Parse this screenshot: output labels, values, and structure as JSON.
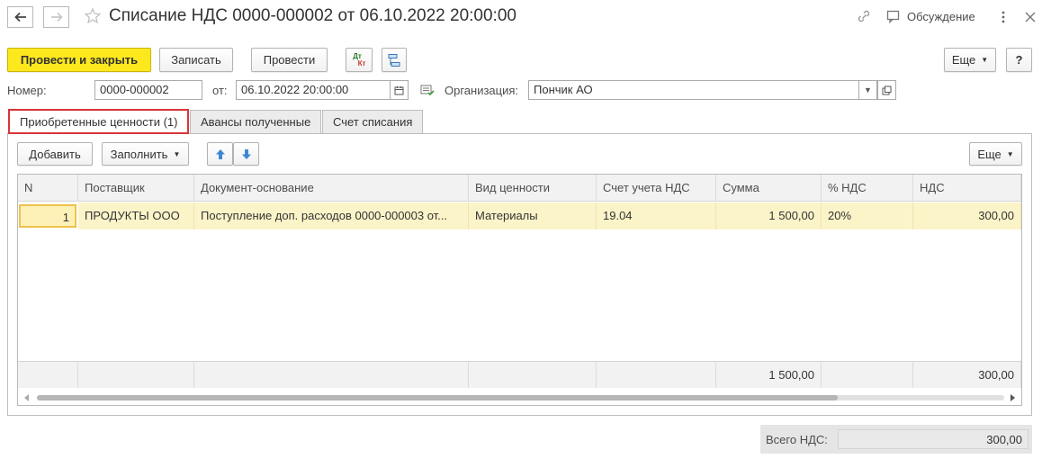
{
  "window": {
    "title": "Списание НДС 0000-000002 от 06.10.2022 20:00:00",
    "discussion_label": "Обсуждение"
  },
  "toolbar": {
    "post_and_close": "Провести и закрыть",
    "save": "Записать",
    "post": "Провести",
    "dt_label": "Дт",
    "kt_label": "Кт",
    "more": "Еще",
    "help": "?"
  },
  "form": {
    "number_label": "Номер:",
    "number_value": "0000-000002",
    "date_label": "от:",
    "date_value": "06.10.2022 20:00:00",
    "org_label": "Организация:",
    "org_value": "Пончик АО"
  },
  "tabs": [
    {
      "label": "Приобретенные ценности (1)",
      "active": true
    },
    {
      "label": "Авансы полученные",
      "active": false
    },
    {
      "label": "Счет списания",
      "active": false
    }
  ],
  "table_toolbar": {
    "add": "Добавить",
    "fill": "Заполнить",
    "more": "Еще"
  },
  "table": {
    "columns": [
      "N",
      "Поставщик",
      "Документ-основание",
      "Вид ценности",
      "Счет учета НДС",
      "Сумма",
      "% НДС",
      "НДС"
    ],
    "rows": [
      [
        "1",
        "ПРОДУКТЫ ООО",
        "Поступление доп. расходов 0000-000003 от...",
        "Материалы",
        "19.04",
        "1 500,00",
        "20%",
        "300,00"
      ]
    ],
    "footer": {
      "sum": "1 500,00",
      "vat": "300,00"
    }
  },
  "totals": {
    "vat_label": "Всего НДС:",
    "vat_value": "300,00"
  },
  "colors": {
    "primary_button": "#fce81d",
    "selected_row": "#fcf4c9",
    "active_tab_border": "#d9343a"
  }
}
